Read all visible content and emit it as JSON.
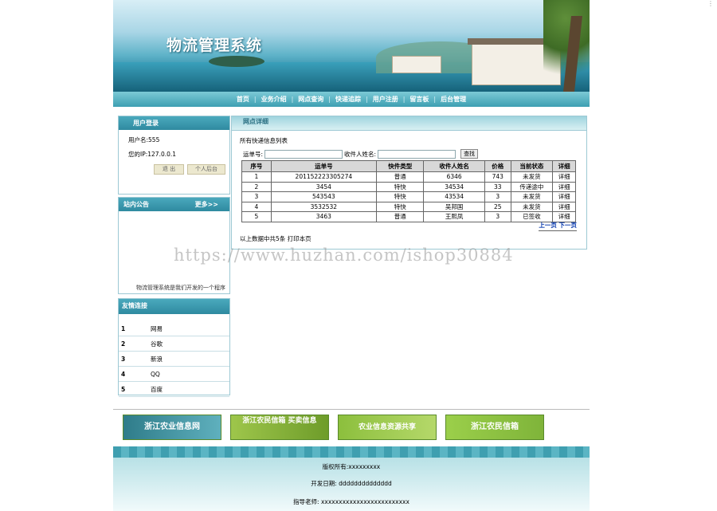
{
  "header": {
    "title": "物流管理系统"
  },
  "nav": [
    "首页",
    "业务介绍",
    "网点查询",
    "快递追踪",
    "用户注册",
    "留言板",
    "后台管理"
  ],
  "login": {
    "title": "用户登录",
    "username": "用户名:555",
    "ip": "您的IP:127.0.0.1",
    "logout": "退 出",
    "personal": "个人后台"
  },
  "notice": {
    "title": "站内公告",
    "more": "更多>>",
    "ticker": "物流管理系统是我们开发的一个程序"
  },
  "links": {
    "title": "友情连接",
    "items": [
      {
        "n": "1",
        "name": "网易"
      },
      {
        "n": "2",
        "name": "谷歌"
      },
      {
        "n": "3",
        "name": "新浪"
      },
      {
        "n": "4",
        "name": "QQ"
      },
      {
        "n": "5",
        "name": "百度"
      }
    ]
  },
  "main": {
    "tab": "网点详细",
    "list_title": "所有快递信息列表",
    "search": {
      "waybill_label": "运单号:",
      "receiver_label": "收件人姓名:",
      "button": "查找"
    },
    "columns": [
      "序号",
      "运单号",
      "快件类型",
      "收件人姓名",
      "价格",
      "当前状态",
      "详细"
    ],
    "rows": [
      [
        "1",
        "201152223305274",
        "普通",
        "6346",
        "743",
        "未发货",
        "详细"
      ],
      [
        "2",
        "3454",
        "特快",
        "34534",
        "33",
        "传递途中",
        "详细"
      ],
      [
        "3",
        "543543",
        "特快",
        "43534",
        "3",
        "未发货",
        "详细"
      ],
      [
        "4",
        "3532532",
        "特快",
        "吴邦国",
        "25",
        "未发货",
        "详细"
      ],
      [
        "5",
        "3463",
        "普通",
        "王熙凤",
        "3",
        "已签收",
        "详细"
      ]
    ],
    "pager": {
      "prev": "上一页",
      "next": "下一页"
    },
    "summary": "以上数据中共5条  打印本页"
  },
  "ads": [
    "浙江农业信息网",
    "浙江农民信箱 买卖信息",
    "农业信息资源共享",
    "浙江农民信箱"
  ],
  "footer": {
    "copyright": "版权所有:xxxxxxxxx",
    "dev_date": "开发日期: dddddddddddddd",
    "teacher": "指导老师: xxxxxxxxxxxxxxxxxxxxxxxxx"
  },
  "watermark": "https://www.huzhan.com/ishop30884",
  "colors": {
    "teal": "#3d9fb2",
    "link_blue": "#0033aa",
    "ad_green": "#8fbf3a"
  }
}
